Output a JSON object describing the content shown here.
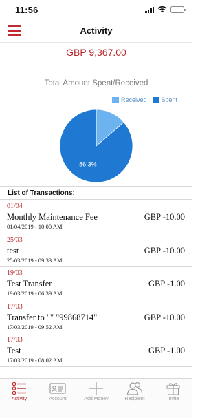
{
  "status_bar": {
    "time": "11:56"
  },
  "header": {
    "title": "Activity",
    "menu_icon": "hamburger-menu-icon"
  },
  "balance": "GBP  9,367.00",
  "chart_data": {
    "type": "pie",
    "title": "Total Amount Spent/Received",
    "legend": [
      "Received",
      "Spent"
    ],
    "legend_position": "top-right",
    "slices": [
      {
        "name": "Received",
        "value": 13.7,
        "color": "#6db3ef"
      },
      {
        "name": "Spent",
        "value": 86.3,
        "color": "#1f78d1"
      }
    ],
    "data_labels": [
      "",
      "86.3%"
    ]
  },
  "list_title": "List of Transactions:",
  "transactions": [
    {
      "date_short": "01/04",
      "name": "Monthly Maintenance Fee",
      "amount": "GBP  -10.00",
      "datetime": "01/04/2019 - 10:00 AM"
    },
    {
      "date_short": "25/03",
      "name": "test",
      "amount": "GBP  -10.00",
      "datetime": "25/03/2019 - 09:33 AM"
    },
    {
      "date_short": "19/03",
      "name": "Test Transfer",
      "amount": "GBP  -1.00",
      "datetime": "19/03/2019 - 06:39 AM"
    },
    {
      "date_short": "17/03",
      "name": "Transfer to \"\" \"99868714\"",
      "amount": "GBP  -10.00",
      "datetime": "17/03/2019 - 09:52 AM"
    },
    {
      "date_short": "17/03",
      "name": "Test",
      "amount": "GBP  -1.00",
      "datetime": "17/03/2019 - 08:02 AM"
    }
  ],
  "tabs": [
    {
      "label": "Activity",
      "icon": "activity-list-icon",
      "active": true
    },
    {
      "label": "Account",
      "icon": "account-card-icon",
      "active": false
    },
    {
      "label": "Add Money",
      "icon": "plus-icon",
      "active": false
    },
    {
      "label": "Recipient",
      "icon": "recipient-people-icon",
      "active": false
    },
    {
      "label": "Invite",
      "icon": "gift-icon",
      "active": false
    }
  ],
  "colors": {
    "accent": "#b8282c",
    "received": "#6db3ef",
    "spent": "#1f78d1"
  }
}
